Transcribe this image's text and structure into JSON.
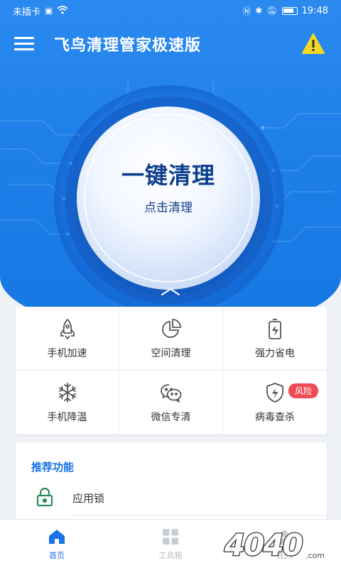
{
  "status_bar": {
    "carrier": "未插卡",
    "time": "19:48",
    "icons": [
      "sim-icon",
      "wifi-icon",
      "nfc-icon",
      "bluetooth-icon",
      "mute-icon",
      "battery-icon"
    ]
  },
  "app": {
    "title": "飞鸟清理管家极速版",
    "menu_icon": "hamburger-icon",
    "warning_icon": "warning-icon"
  },
  "clean_button": {
    "title": "一键清理",
    "subtitle": "点击清理"
  },
  "tools": [
    {
      "label": "手机加速",
      "icon": "rocket-icon"
    },
    {
      "label": "空间清理",
      "icon": "pie-chart-icon"
    },
    {
      "label": "强力省电",
      "icon": "battery-bolt-icon"
    },
    {
      "label": "手机降温",
      "icon": "snowflake-icon"
    },
    {
      "label": "微信专清",
      "icon": "wechat-icon"
    },
    {
      "label": "病毒查杀",
      "icon": "shield-bolt-icon",
      "badge": "风险"
    }
  ],
  "recommend": {
    "title": "推荐功能",
    "items": [
      {
        "label": "应用锁",
        "icon": "lock-icon"
      }
    ]
  },
  "bottom_nav": [
    {
      "label": "首页",
      "icon": "home-icon",
      "active": true
    },
    {
      "label": "工具箱",
      "icon": "grid-icon",
      "active": false
    },
    {
      "label": "我的",
      "icon": "profile-icon",
      "active": false
    }
  ],
  "watermark": {
    "text": "4040.com"
  },
  "colors": {
    "primary": "#1a73e8",
    "hero_blue": "#1f7fe9",
    "badge_red": "#ef4b55",
    "lock_green": "#2b8a5e"
  }
}
